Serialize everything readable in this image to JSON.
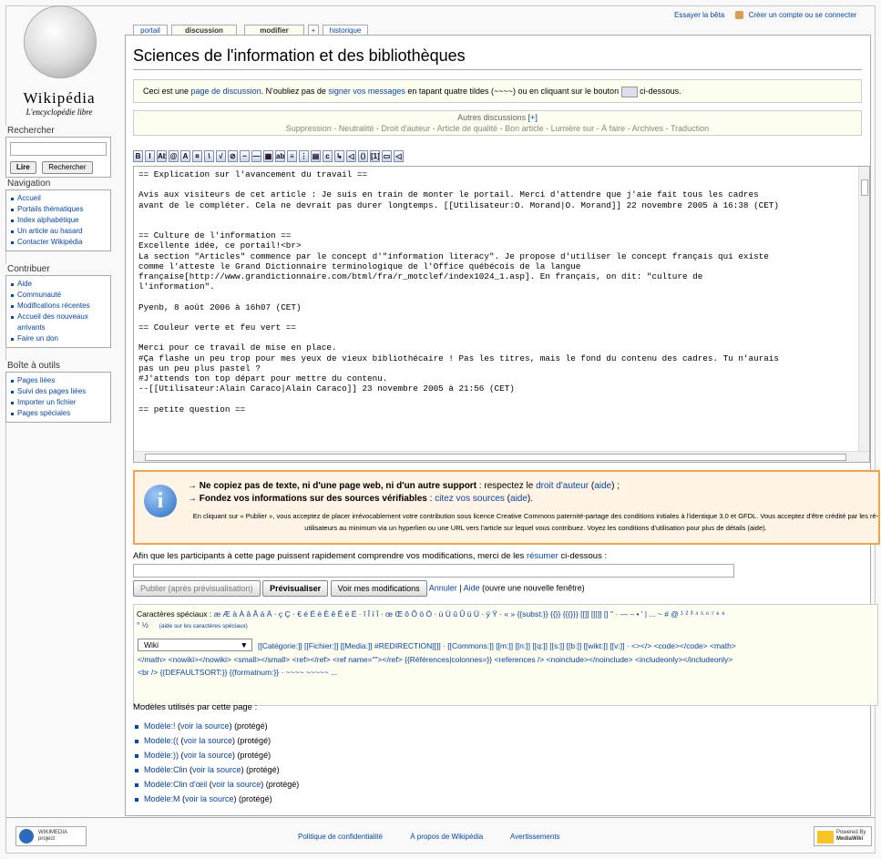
{
  "personal": {
    "beta": "Essayer la bêta",
    "login": "Créer un compte ou se connecter"
  },
  "logo": {
    "name": "Wikipédia",
    "subtitle": "L'encyclopédie libre"
  },
  "tabs": [
    {
      "label": "portail",
      "selected": false
    },
    {
      "label": "discussion",
      "selected": true
    },
    {
      "label": "modifier",
      "selected": true
    },
    {
      "label": "+",
      "selected": false
    },
    {
      "label": "historique",
      "selected": false
    }
  ],
  "search": {
    "heading": "Rechercher",
    "go": "Lire",
    "search": "Rechercher"
  },
  "navigation": {
    "heading": "Navigation",
    "items": [
      "Accueil",
      "Portails thématiques",
      "Index alphabétique",
      "Un article au hasard",
      "Contacter Wikipédia"
    ]
  },
  "contribuer": {
    "heading": "Contribuer",
    "items": [
      "Aide",
      "Communauté",
      "Modifications récentes",
      "Accueil des nouveaux arrivants",
      "Faire un don"
    ]
  },
  "toolbox": {
    "heading": "Boîte à outils",
    "items": [
      "Pages liées",
      "Suivi des pages liées",
      "Importer un fichier",
      "Pages spéciales"
    ]
  },
  "page_title": "Sciences de l'information et des bibliothèques",
  "notice": {
    "t1": "Ceci est une ",
    "link1": "page de discussion",
    "t2": ". N'oubliez pas de ",
    "link2": "signer vos messages",
    "t3": " en tapant quatre tildes (~~~~) ou en cliquant sur le bouton ",
    "t4": " ci-dessous."
  },
  "other_discussions": {
    "heading": "Autres discussions",
    "plus": "[+]",
    "links": "Suppression - Neutralité - Droit d'auteur - Article de qualité - Bon article - Lumière sur - À faire - Archives - Traduction"
  },
  "toolbar_buttons": [
    "B",
    "I",
    "Ab",
    "@",
    "A",
    "¤",
    "\\",
    "√",
    "⊘",
    "~",
    "—",
    "▦",
    "ab",
    "≡",
    "⋮",
    "▤",
    "c",
    "↳",
    "◁",
    "⟨⟩",
    "[1]",
    "▭",
    "◁"
  ],
  "editor_text": "== Explication sur l'avancement du travail ==\n\nAvis aux visiteurs de cet article : Je suis en train de monter le portail. Merci d'attendre que j'aie fait tous les cadres\navant de le compléter. Cela ne devrait pas durer longtemps. [[Utilisateur:O. Morand|O. Morand]] 22 novembre 2005 à 16:38 (CET)\n\n\n== Culture de l'information ==\nExcellente idée, ce portail!<br>\nLa section \"Articles\" commence par le concept d'\"information literacy\". Je propose d'utiliser le concept français qui existe\ncomme l'atteste le Grand Dictionnaire terminologique de l'Office québécois de la langue\nfrançaise[http://www.grandictionnaire.com/btml/fra/r_motclef/index1024_1.asp]. En français, on dit: \"culture de\nl'information\".\n\nPyenb, 8 août 2006 à 16h07 (CET)\n\n== Couleur verte et feu vert ==\n\nMerci pour ce travail de mise en place.\n#Ça flashe un peu trop pour mes yeux de vieux bibliothécaire ! Pas les titres, mais le fond du contenu des cadres. Tu n'aurais\npas un peu plus pastel ?\n#J'attends ton top départ pour mettre du contenu.\n--[[Utilisateur:Alain Caraco|Alain Caraco]] 23 novembre 2005 à 21:56 (CET)\n\n== petite question ==",
  "warning": {
    "l1a": "→ Ne copiez pas de texte, ni d'une page web, ni d'un autre support",
    "l1b": " : respectez le ",
    "l1c": "droit d'auteur",
    "l1d": " (",
    "l1e": "aide",
    "l1f": ") ;",
    "l2a": "→ Fondez vos informations sur des sources vérifiables",
    "l2b": " : ",
    "l2c": "citez vos sources",
    "l2d": " (",
    "l2e": "aide",
    "l2f": ").",
    "l3": "En cliquant sur « Publier », vous acceptez de placer irrévocablement votre contribution sous licence Creative Commons paternité-partage des conditions initiales à l'identique 3.0 et GFDL. Vous acceptez d'être crédité par les ré-utilisateurs au minimum via un hyperlien ou une URL vers l'article sur lequel vous contribuez. Voyez les conditions d'utilisation pour plus de détails (aide)."
  },
  "summary": {
    "label_a": "Afin que les participants à cette page puissent rapidement comprendre vos modifications, merci de les ",
    "label_link": "résumer",
    "label_b": " ci-dessous :",
    "value": ""
  },
  "buttons": {
    "publish": "Publier (après prévisualisation)",
    "preview": "Prévisualiser",
    "diff": "Voir mes modifications",
    "cancel": "Annuler",
    "sep": " | ",
    "help": "Aide",
    "help_note": " (ouvre une nouvelle fenêtre)"
  },
  "special": {
    "label": "Caractères spéciaux : ",
    "chars": "æ Æ à À â Â ä Ä · ç Ç · € é É è È ê Ê ë Ë · î Î ï Ï · œ Œ ô Ô ö Ö · ù Ù û Û ü Ü · ÿ Ÿ · « » {{subst:}} {{}} {{{}}} [[]] [[|]] [] \" · — – • ' | ... ~ # @ ¹ ² ³ ⁴ ⁵ ⁶ ⁷ ⁸ ⁹",
    "frac": "° ½",
    "help": "(aide sur les caractères spéciaux)",
    "select": "Wiki",
    "wiki1": "[[Catégorie:]] [[Fichier:]] [[Media:]] #REDIRECTION[[]] · [[Commons:]] [[m:]] [[n:]] [[q:]] [[s:]] [[b:]] [[wikt:]] [[v:]] · <></> <code></code> <math>",
    "wiki2": "</math> <nowiki></nowiki> <small></small> <ref></ref> <ref name=\"\"></ref> {{Références|colonnes=}} <references /> <noinclude></noinclude> <includeonly></includeonly>",
    "wiki3": "<br /> {{DEFAULTSORT:}} {{formatnum:}} · ~~~~ ~~~~~ ..."
  },
  "templates": {
    "heading": "Modèles utilisés par cette page :",
    "items": [
      {
        "name": "Modèle:!",
        "src": "voir la source",
        "prot": "(protégé)"
      },
      {
        "name": "Modèle:((",
        "src": "voir la source",
        "prot": "(protégé)"
      },
      {
        "name": "Modèle:))",
        "src": "voir la source",
        "prot": "(protégé)"
      },
      {
        "name": "Modèle:Clin",
        "src": "voir la source",
        "prot": "(protégé)"
      },
      {
        "name": "Modèle:Clin d'œil",
        "src": "voir la source",
        "prot": "(protégé)"
      },
      {
        "name": "Modèle:M",
        "src": "voir la source",
        "prot": "(protégé)"
      }
    ]
  },
  "footer": {
    "wikimedia": "WIKIMEDIA",
    "wikimedia_sub": "project",
    "links": [
      "Politique de confidentialité",
      "À propos de Wikipédia",
      "Avertissements"
    ],
    "powered": "Powered By",
    "mediawiki": "MediaWiki"
  }
}
